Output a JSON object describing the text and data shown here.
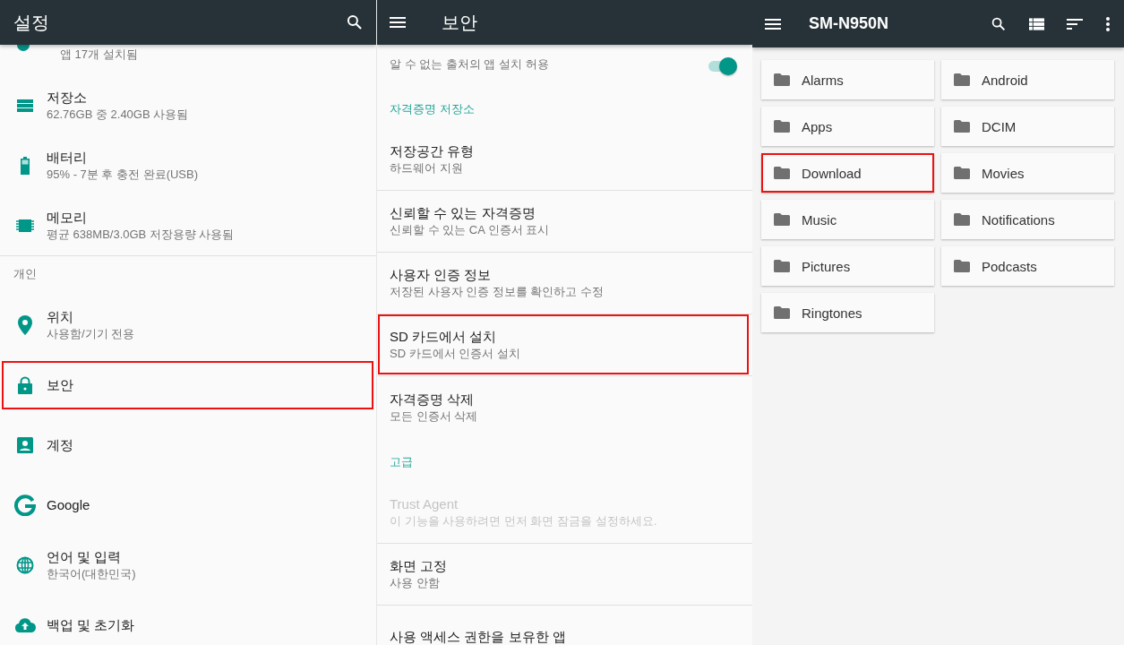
{
  "settings": {
    "title": "설정",
    "rows": [
      {
        "kind": "partial",
        "subtitle": "앱 17개 설치됨",
        "highlighted": false
      },
      {
        "kind": "item",
        "title": "저장소",
        "subtitle": "62.76GB 중 2.40GB 사용됨",
        "highlighted": false
      },
      {
        "kind": "item",
        "title": "배터리",
        "subtitle": "95% - 7분 후 충전 완료(USB)",
        "highlighted": false
      },
      {
        "kind": "item",
        "title": "메모리",
        "subtitle": "평균 638MB/3.0GB 저장용량 사용됨",
        "highlighted": false
      },
      {
        "kind": "header",
        "title": "개인"
      },
      {
        "kind": "item",
        "title": "위치",
        "subtitle": "사용함/기기 전용",
        "highlighted": false
      },
      {
        "kind": "item",
        "title": "보안",
        "highlighted": true
      },
      {
        "kind": "item",
        "title": "계정",
        "highlighted": false
      },
      {
        "kind": "item",
        "title": "Google",
        "highlighted": false
      },
      {
        "kind": "item",
        "title": "언어 및 입력",
        "subtitle": "한국어(대한민국)",
        "highlighted": false
      },
      {
        "kind": "item",
        "title": "백업 및 초기화",
        "highlighted": false
      }
    ]
  },
  "security": {
    "title": "보안",
    "rows": [
      {
        "kind": "toggle",
        "subtitle": "알 수 없는 출처의 앱 설치 허용",
        "on": true,
        "highlighted": false,
        "disabled": false
      },
      {
        "kind": "header",
        "title": "자격증명 저장소"
      },
      {
        "kind": "item",
        "title": "저장공간 유형",
        "subtitle": "하드웨어 지원",
        "highlighted": false,
        "disabled": false
      },
      {
        "kind": "item",
        "title": "신뢰할 수 있는 자격증명",
        "subtitle": "신뢰할 수 있는 CA 인증서 표시",
        "highlighted": false,
        "disabled": false
      },
      {
        "kind": "item",
        "title": "사용자 인증 정보",
        "subtitle": "저장된 사용자 인증 정보를 확인하고 수정",
        "highlighted": false,
        "disabled": false
      },
      {
        "kind": "item",
        "title": "SD 카드에서 설치",
        "subtitle": "SD 카드에서 인증서 설치",
        "highlighted": true,
        "disabled": false
      },
      {
        "kind": "item",
        "title": "자격증명 삭제",
        "subtitle": "모든 인증서 삭제",
        "highlighted": false,
        "disabled": false
      },
      {
        "kind": "header",
        "title": "고급"
      },
      {
        "kind": "item",
        "title": "Trust Agent",
        "subtitle": "이 기능을 사용하려면 먼저 화면 잠금을 설정하세요.",
        "highlighted": false,
        "disabled": true
      },
      {
        "kind": "item",
        "title": "화면 고정",
        "subtitle": "사용 안함",
        "highlighted": false,
        "disabled": false
      },
      {
        "kind": "item",
        "title": "사용 액세스 권한을 보유한 앱",
        "highlighted": false,
        "disabled": false
      }
    ]
  },
  "files": {
    "title": "SM-N950N",
    "folders": [
      {
        "name": "Alarms",
        "highlighted": false
      },
      {
        "name": "Android",
        "highlighted": false
      },
      {
        "name": "Apps",
        "highlighted": false
      },
      {
        "name": "DCIM",
        "highlighted": false
      },
      {
        "name": "Download",
        "highlighted": true
      },
      {
        "name": "Movies",
        "highlighted": false
      },
      {
        "name": "Music",
        "highlighted": false
      },
      {
        "name": "Notifications",
        "highlighted": false
      },
      {
        "name": "Pictures",
        "highlighted": false
      },
      {
        "name": "Podcasts",
        "highlighted": false
      },
      {
        "name": "Ringtones",
        "highlighted": false
      }
    ]
  }
}
